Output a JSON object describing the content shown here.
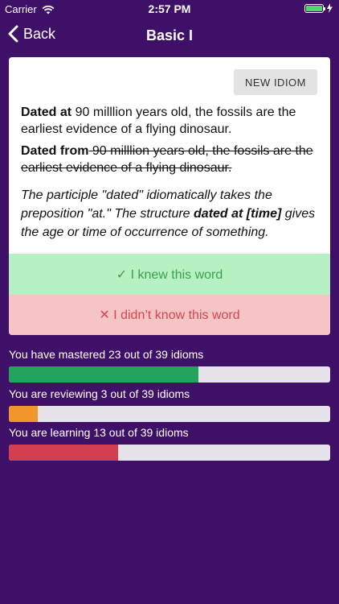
{
  "status_bar": {
    "carrier": "Carrier",
    "time": "2:57 PM",
    "battery_color": "#4cd964"
  },
  "nav": {
    "back_label": "Back",
    "title": "Basic I"
  },
  "card": {
    "new_idiom_label": "NEW IDIOM",
    "correct": {
      "bold": "Dated at",
      "rest": " 90 milllion years old, the fossils are the earliest evidence of a flying dinosaur."
    },
    "wrong": {
      "bold": "Dated from",
      "rest": " 90 milllion years old, the fossils are the earliest evidence of a flying dinosaur."
    },
    "explanation": {
      "part1": "The participle \"dated\" idiomatically takes the preposition \"at.\"  The structure ",
      "bold": "dated at [time]",
      "part2": " gives the age or time of occurrence of something."
    },
    "knew_label": "✓ I knew this word",
    "didnt_know_label": "✕ I didn’t know this word"
  },
  "progress": [
    {
      "label": "You have mastered 23 out of 39 idioms",
      "fraction": 0.59,
      "color": "#22a45d"
    },
    {
      "label": "You are reviewing 3 out of 39 idioms",
      "fraction": 0.09,
      "color": "#f0962a"
    },
    {
      "label": "You are learning 13 out of 39 idioms",
      "fraction": 0.34,
      "color": "#d43f4f"
    }
  ]
}
